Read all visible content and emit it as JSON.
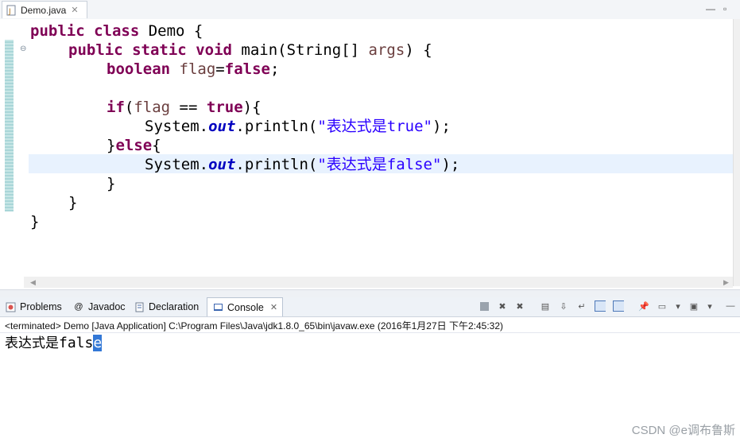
{
  "editor_tab": {
    "filename": "Demo.java",
    "close": "✕",
    "icon": "java-file-icon"
  },
  "window_controls": {
    "minimize": "—",
    "maximize": "▫"
  },
  "code": {
    "l1": {
      "kw1": "public",
      "kw2": "class",
      "rest": " Demo {"
    },
    "l2": {
      "kw1": "public",
      "kw2": "static",
      "kw3": "void",
      "rest1": " main(String[] ",
      "arg": "args",
      "rest2": ") {"
    },
    "l3": {
      "kw1": "boolean",
      "var": "flag",
      "eq": "=",
      "kw2": "false",
      "semi": ";"
    },
    "l4": {
      "kw1": "if",
      "p1": "(",
      "var": "flag",
      "op": " == ",
      "kw2": "true",
      "p2": "){"
    },
    "l5": {
      "sys": "System.",
      "fld": "out",
      "call": ".println(",
      "str": "\"表达式是true\"",
      "end": ");"
    },
    "l6": {
      "b1": "}",
      "kw": "else",
      "b2": "{"
    },
    "l7": {
      "sys": "System.",
      "fld": "out",
      "call": ".println(",
      "str": "\"表达式是false\"",
      "end": ");"
    },
    "l8": "}",
    "l9": "}",
    "l10": "}"
  },
  "views": {
    "problems": "Problems",
    "javadoc": "Javadoc",
    "declaration": "Declaration",
    "console": "Console",
    "console_close": "✕"
  },
  "console": {
    "status": "<terminated> Demo [Java Application] C:\\Program Files\\Java\\jdk1.8.0_65\\bin\\javaw.exe (2016年1月27日 下午2:45:32)",
    "output_prefix": "表达式是",
    "output_mono": "fals",
    "output_selected": "e"
  },
  "watermark": "CSDN @e调布鲁斯",
  "colors": {
    "keyword": "#7f0055",
    "string": "#2a00ff",
    "field": "#0000c0",
    "selection": "#3378d6"
  }
}
